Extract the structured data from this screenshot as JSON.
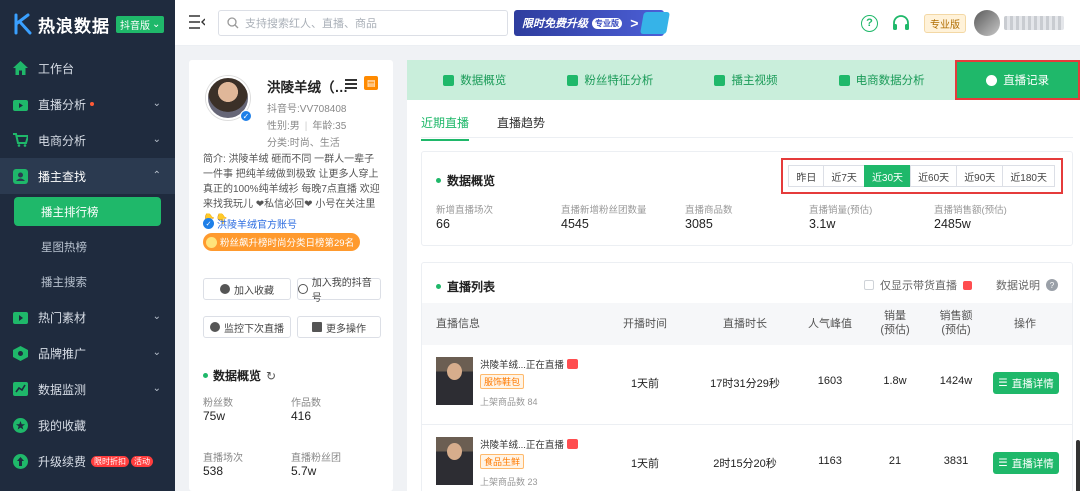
{
  "brand": {
    "name": "热浪数据",
    "badge": "抖音版"
  },
  "sidebar": {
    "items": [
      {
        "label": "工作台",
        "icon": "home-icon"
      },
      {
        "label": "直播分析",
        "icon": "live-icon",
        "has_dot": true
      },
      {
        "label": "电商分析",
        "icon": "cart-icon"
      },
      {
        "label": "播主查找",
        "icon": "search-user-icon",
        "open": true,
        "children": [
          "播主排行榜",
          "星图热榜",
          "播主搜索"
        ]
      },
      {
        "label": "热门素材",
        "icon": "video-icon"
      },
      {
        "label": "品牌推广",
        "icon": "brand-icon"
      },
      {
        "label": "数据监测",
        "icon": "monitor-icon"
      },
      {
        "label": "我的收藏",
        "icon": "star-icon"
      },
      {
        "label": "升级续费",
        "icon": "upgrade-icon",
        "badges": [
          "限时折扣",
          "活动"
        ]
      }
    ]
  },
  "topbar": {
    "search_placeholder": "支持搜索红人、直播、商品",
    "promo_text": "限时免费升级",
    "promo_badge": "专业版",
    "plan": "专业版"
  },
  "profile": {
    "name": "洪陵羊绒（…",
    "douyin_id": "抖音号:VV708408",
    "gender": "性别:男",
    "age": "年龄:35",
    "category": "分类:时尚、生活",
    "bio": "简介: 洪陵羊绒 砸而不同 一群人一辈子一件事 把纯羊绒做到极致 让更多人穿上真正的100%纯羊绒衫 每晚7点直播 欢迎来找我玩儿 ❤私信必回❤ 小号在关注里👇👇",
    "official": "洪陵羊绒官方账号",
    "rank": "粉丝飙升榜时尚分类日榜第29名",
    "buttons": {
      "collect": "加入收藏",
      "add_to_mine": "加入我的抖音号",
      "monitor": "监控下次直播",
      "more": "更多操作"
    },
    "overview_title": "数据概览",
    "stats": [
      {
        "label": "粉丝数",
        "value": "75w"
      },
      {
        "label": "作品数",
        "value": "416"
      },
      {
        "label": "直播场次",
        "value": "538"
      },
      {
        "label": "直播粉丝团",
        "value": "5.7w"
      }
    ]
  },
  "main": {
    "tabs": [
      {
        "label": "数据概览",
        "icon": "chart-icon"
      },
      {
        "label": "粉丝特征分析",
        "icon": "fans-icon"
      },
      {
        "label": "播主视频",
        "icon": "video-icon"
      },
      {
        "label": "电商数据分析",
        "icon": "shop-icon"
      },
      {
        "label": "直播记录",
        "icon": "clock-icon",
        "active": true
      }
    ],
    "subtabs": [
      "近期直播",
      "直播趋势"
    ],
    "overview": {
      "title": "数据概览",
      "ranges": [
        "昨日",
        "近7天",
        "近30天",
        "近60天",
        "近90天",
        "近180天"
      ],
      "active_range": "近30天",
      "metrics": [
        {
          "label": "新增直播场次",
          "value": "66"
        },
        {
          "label": "直播新增粉丝团数量",
          "value": "4545"
        },
        {
          "label": "直播商品数",
          "value": "3085"
        },
        {
          "label": "直播销量(预估)",
          "value": "3.1w"
        },
        {
          "label": "直播销售额(预估)",
          "value": "2485w"
        }
      ]
    },
    "list": {
      "title": "直播列表",
      "only_goods": "仅显示带货直播",
      "data_note": "数据说明",
      "headers": [
        "直播信息",
        "开播时间",
        "直播时长",
        "人气峰值",
        "销量\n(预估)",
        "销售额\n(预估)",
        "操作"
      ],
      "rows": [
        {
          "title": "洪陵羊绒...正在直播",
          "tag": "服饰鞋包",
          "goods": "上架商品数 84",
          "start": "1天前",
          "duration": "17时31分29秒",
          "peak": "1603",
          "sales": "1.8w",
          "revenue": "1424w",
          "action": "直播详情"
        },
        {
          "title": "洪陵羊绒...正在直播",
          "tag": "食品生鲜",
          "goods": "上架商品数 23",
          "start": "1天前",
          "duration": "2时15分20秒",
          "peak": "1163",
          "sales": "21",
          "revenue": "3831",
          "action": "直播详情"
        }
      ]
    }
  }
}
